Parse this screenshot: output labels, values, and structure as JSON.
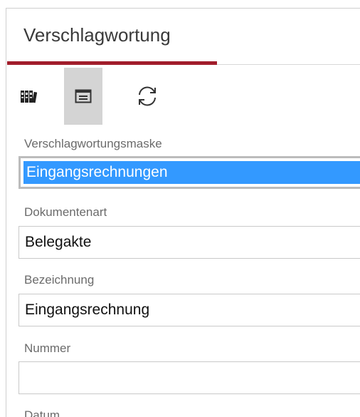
{
  "panel": {
    "title": "Verschlagwortung",
    "accent_color": "#a11d2b",
    "selection_color": "#3399ff"
  },
  "toolbar": {
    "buttons": [
      {
        "icon": "binders-icon",
        "active": false
      },
      {
        "icon": "form-mask-icon",
        "active": true
      },
      {
        "icon": "refresh-icon",
        "active": false
      }
    ]
  },
  "fields": {
    "mask": {
      "label": "Verschlagwortungsmaske",
      "value": "Eingangsrechnungen",
      "selected": true
    },
    "doctype": {
      "label": "Dokumentenart",
      "value": "Belegakte"
    },
    "name": {
      "label": "Bezeichnung",
      "value": "Eingangsrechnung"
    },
    "number": {
      "label": "Nummer",
      "value": ""
    },
    "date": {
      "label": "Datum"
    }
  }
}
